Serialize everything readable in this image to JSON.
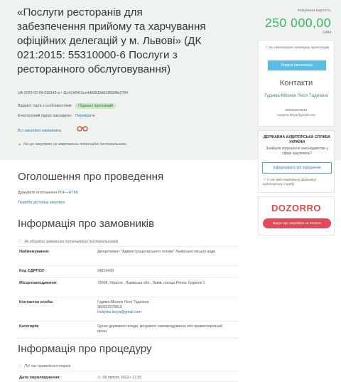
{
  "tender": {
    "title": "«Послуги ресторанів для забезпечення прийому та харчування офіційних делегацій у м. Львові» (ДК 021:2015: 55310000-6 Послуги з ресторанного обслуговування)",
    "id": "UA-2023-02-09-018143-a  •  11c42d0415ce4d60819d618558ffe2784",
    "procedure_type": "Відкриті торги з особливостями",
    "status_badge": "Подання пропозицій",
    "signature_text": "Електронний підпис накладено.",
    "signature_link": "Перевірити",
    "favorites_link": "Всі закупівлі замовника",
    "discussion_note": "На цю закупівлю не звертались потенційні постачальники"
  },
  "price": {
    "label": "очікувана вартість",
    "amount": "250 000,00",
    "currency": "UAH"
  },
  "offer_card": {
    "warning": "Ви підготуєте тендерну пропозицію",
    "submit_label": "Подати пропозицію",
    "contacts_heading": "Контакти",
    "contact_name": "Гудима-Місеюк Леся Тадеївна",
    "contact_phone": "380322975819",
    "contact_email": "hudyma.lesya@gmail.com"
  },
  "audit_card": {
    "heading": "ДЕРЖАВНА АУДИТОРСЬКА СЛУЖБА УКРАЇНИ",
    "question": "Знайшли порушення законодавства у сфері закупівель?",
    "inform_label": "Інформувати про порушення",
    "already_note": "У нас вже повідомили Державну аудиторську службу"
  },
  "dozorro_card": {
    "logo": "DOZORRO",
    "button_label": "Відгук про закупівлю на Dozorro"
  },
  "announcement": {
    "heading": "Оголошення про проведення",
    "print_prefix": "Друкувати оголошення",
    "print_pdf": "PDF",
    "print_sep": "•",
    "print_html": "HTML",
    "goto_plan": "Перейти до плану закупівлі"
  },
  "customer": {
    "heading": "Інформація про замовників",
    "note": "Як обирати замовника потенційним постачальникам",
    "rows": [
      {
        "key": "Найменування:",
        "value": "Департамент \"Адміністрація міського голови\" Львівської міської ради"
      },
      {
        "key": "Код ЄДРПОУ:",
        "value": "34814439"
      },
      {
        "key": "Місцезнаходження:",
        "value": "79008, Україна , Львівська обл., Львів, площа Ринок, будинок 1"
      },
      {
        "key": "Контактна особа:",
        "value": "Гудима-Місеюк Леся Тадеївна",
        "phone": "380322975819",
        "email": "Hudyma.lesya@gmail.com"
      },
      {
        "key": "Категорія:",
        "value": "Орган державної влади, місцевого самоврядування або правоохоронний орган"
      }
    ]
  },
  "procedure": {
    "heading": "Інформація про процедуру",
    "note": "Під час проведення торгів",
    "date_key": "Дата оприлюднення:",
    "date_value": "09 лютого 2023  •  17:25"
  }
}
